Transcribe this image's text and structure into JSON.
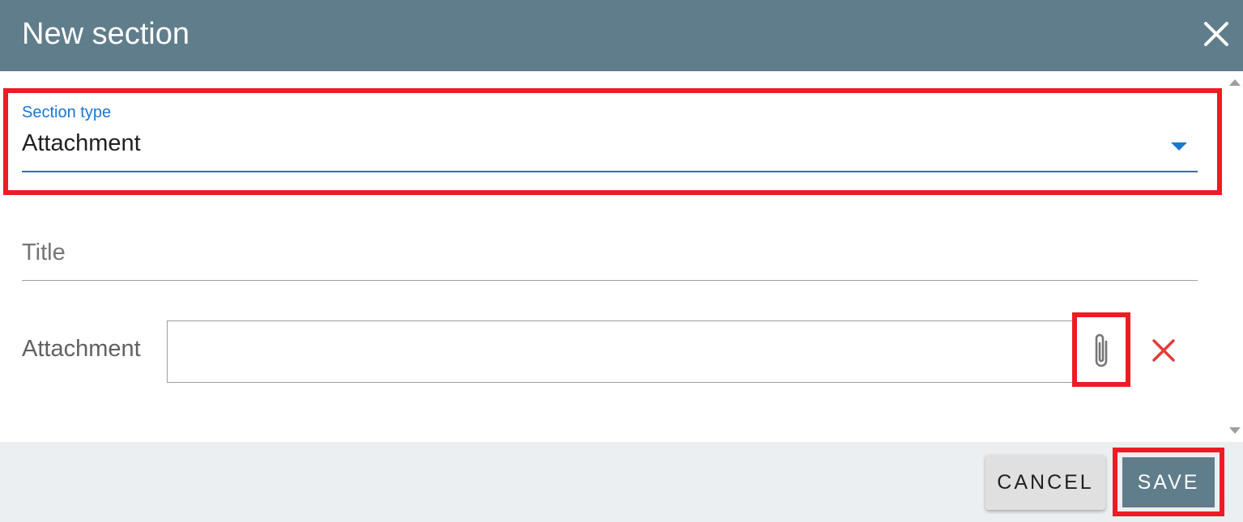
{
  "dialog": {
    "title": "New section"
  },
  "form": {
    "section_type": {
      "label": "Section type",
      "value": "Attachment"
    },
    "title_field": {
      "placeholder": "Title",
      "value": ""
    },
    "attachment": {
      "label": "Attachment",
      "value": ""
    }
  },
  "footer": {
    "cancel_label": "CANCEL",
    "save_label": "SAVE"
  },
  "icons": {
    "close": "close-icon",
    "dropdown": "dropdown-arrow-icon",
    "attach": "paperclip-icon",
    "remove": "remove-icon"
  },
  "colors": {
    "header_bg": "#607d8b",
    "accent": "#1976d2",
    "remove": "#e53935",
    "highlight": "#ed1c24",
    "footer_bg": "#eceff1"
  }
}
